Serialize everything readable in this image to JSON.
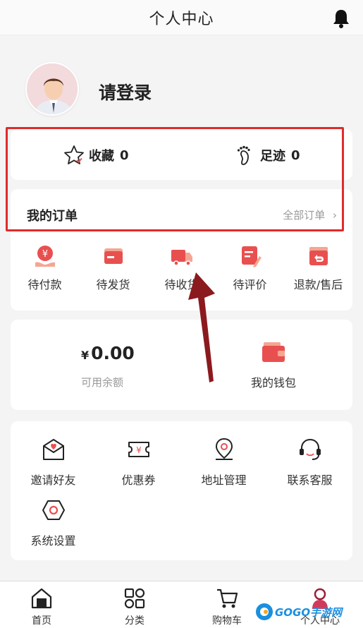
{
  "header": {
    "title": "个人中心",
    "bell_icon": "bell-icon"
  },
  "profile": {
    "login_text": "请登录",
    "avatar_icon": "user-avatar"
  },
  "favorites": {
    "collect_label": "收藏",
    "collect_count": "0",
    "footprint_label": "足迹",
    "footprint_count": "0"
  },
  "orders": {
    "title": "我的订单",
    "all_label": "全部订单",
    "items": [
      {
        "label": "待付款",
        "icon": "payment-icon"
      },
      {
        "label": "待发货",
        "icon": "card-icon"
      },
      {
        "label": "待收货",
        "icon": "truck-icon"
      },
      {
        "label": "待评价",
        "icon": "review-icon"
      },
      {
        "label": "退款/售后",
        "icon": "refund-icon"
      }
    ]
  },
  "wallet": {
    "currency": "¥",
    "balance": "0.00",
    "balance_label": "可用余额",
    "wallet_label": "我的钱包"
  },
  "tools": [
    {
      "label": "邀请好友",
      "icon": "invite-icon"
    },
    {
      "label": "优惠券",
      "icon": "coupon-icon"
    },
    {
      "label": "地址管理",
      "icon": "location-icon"
    },
    {
      "label": "联系客服",
      "icon": "headset-icon"
    },
    {
      "label": "系统设置",
      "icon": "settings-icon"
    }
  ],
  "tabbar": [
    {
      "label": "首页",
      "icon": "home-icon"
    },
    {
      "label": "分类",
      "icon": "category-icon"
    },
    {
      "label": "购物车",
      "icon": "cart-icon"
    },
    {
      "label": "个人中心",
      "icon": "user-icon"
    }
  ],
  "watermark": {
    "text": "GOGO手游网"
  },
  "colors": {
    "accent": "#e8504f",
    "annotation_red": "#e02b2b",
    "arrow": "#8b1a1f"
  }
}
